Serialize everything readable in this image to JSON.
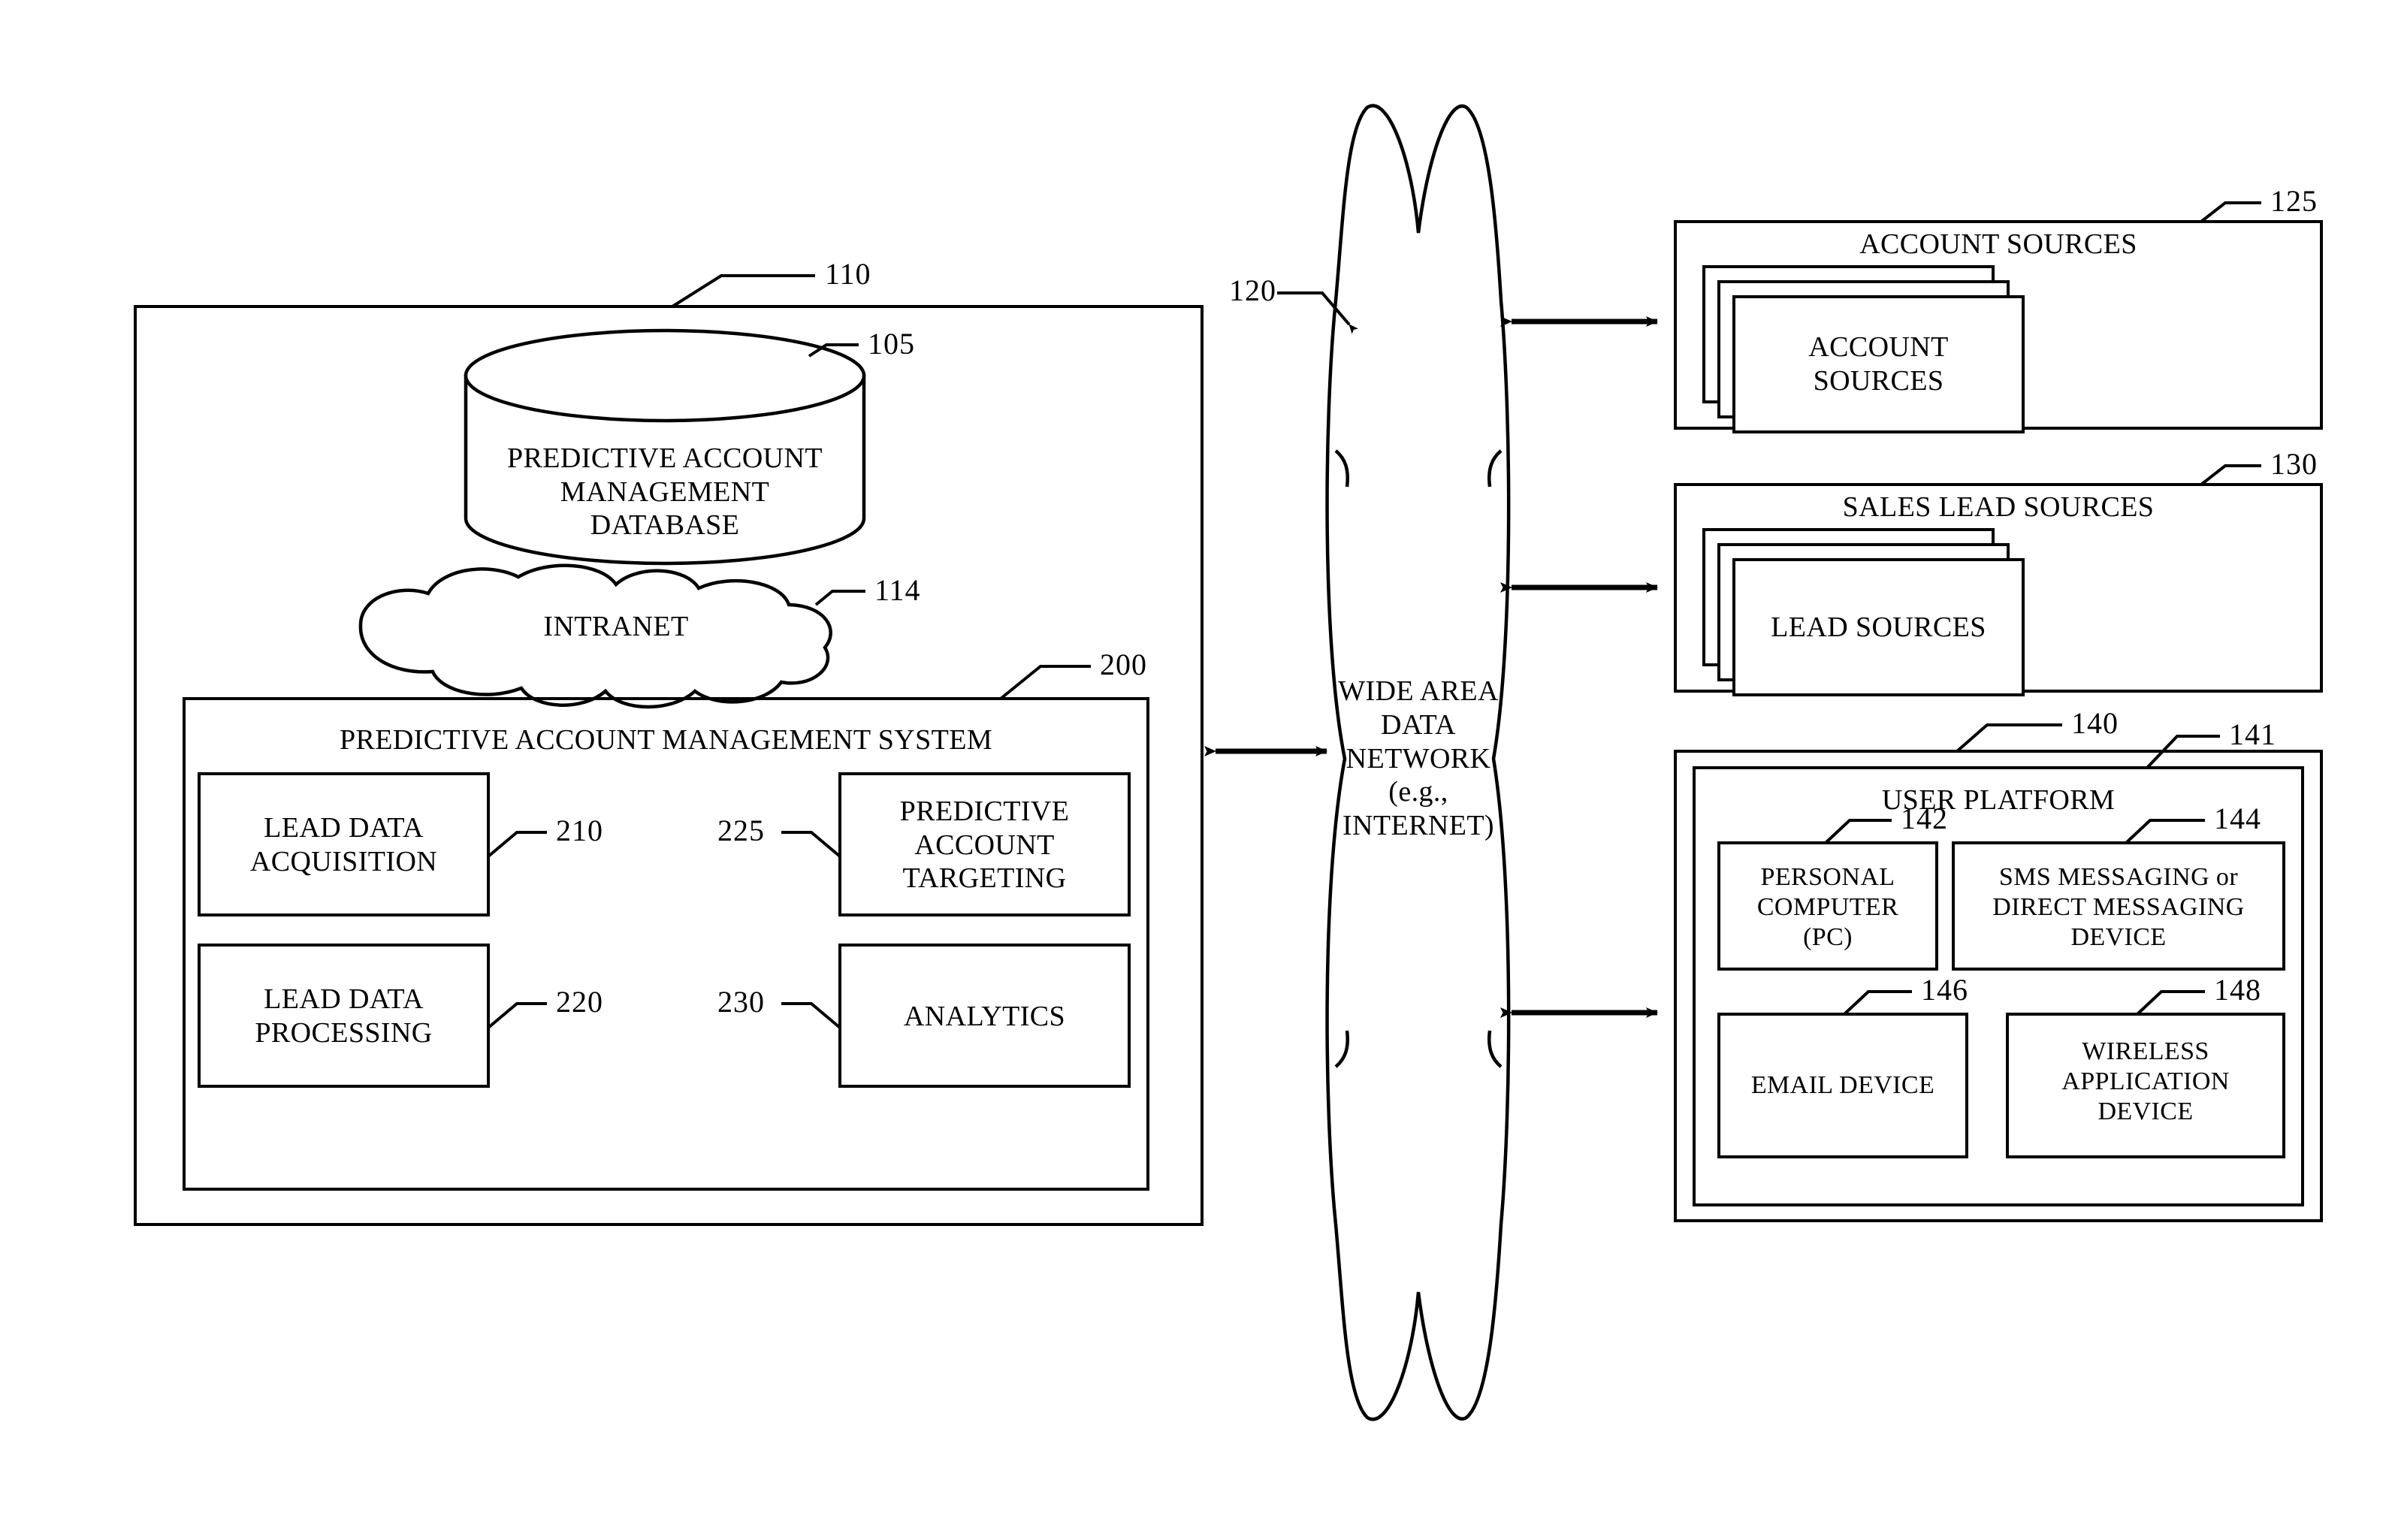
{
  "figure": {
    "type": "patent-system-block-diagram",
    "background": "#ffffff",
    "line_color": "#000000"
  },
  "enterprise": {
    "ref": "110",
    "database": {
      "ref": "105",
      "label": "PREDICTIVE ACCOUNT\nMANAGEMENT\nDATABASE",
      "shape": "cylinder"
    },
    "intranet": {
      "ref": "114",
      "label": "INTRANET",
      "shape": "cloud"
    },
    "system": {
      "ref": "200",
      "title": "PREDICTIVE ACCOUNT MANAGEMENT SYSTEM",
      "modules": [
        {
          "ref": "210",
          "label": "LEAD DATA\nACQUISITION"
        },
        {
          "ref": "220",
          "label": "LEAD DATA\nPROCESSING"
        },
        {
          "ref": "225",
          "label": "PREDICTIVE\nACCOUNT\nTARGETING"
        },
        {
          "ref": "230",
          "label": "ANALYTICS"
        }
      ]
    }
  },
  "network": {
    "ref": "120",
    "label": "WIDE AREA\nDATA\nNETWORK\n(e.g.,\nINTERNET)",
    "shape": "cloud-vertical"
  },
  "account_sources": {
    "ref": "125",
    "title": "ACCOUNT SOURCES",
    "stack_label": "ACCOUNT\nSOURCES",
    "stack_count": 3
  },
  "sales_lead_sources": {
    "ref": "130",
    "title": "SALES LEAD SOURCES",
    "stack_label": "LEAD SOURCES",
    "stack_count": 3
  },
  "user_platform": {
    "outer_ref": "140",
    "inner_ref": "141",
    "title": "USER PLATFORM",
    "devices": [
      {
        "ref": "142",
        "label": "PERSONAL\nCOMPUTER\n(PC)"
      },
      {
        "ref": "144",
        "label": "SMS MESSAGING or\nDIRECT MESSAGING\nDEVICE"
      },
      {
        "ref": "146",
        "label": "EMAIL DEVICE"
      },
      {
        "ref": "148",
        "label": "WIRELESS\nAPPLICATION\nDEVICE"
      }
    ]
  },
  "connectors": [
    {
      "name": "enterprise-to-network",
      "style": "double-arrow"
    },
    {
      "name": "network-to-account-sources",
      "style": "double-arrow"
    },
    {
      "name": "network-to-sales-lead-sources",
      "style": "double-arrow"
    },
    {
      "name": "network-to-user-platform",
      "style": "double-arrow"
    }
  ]
}
